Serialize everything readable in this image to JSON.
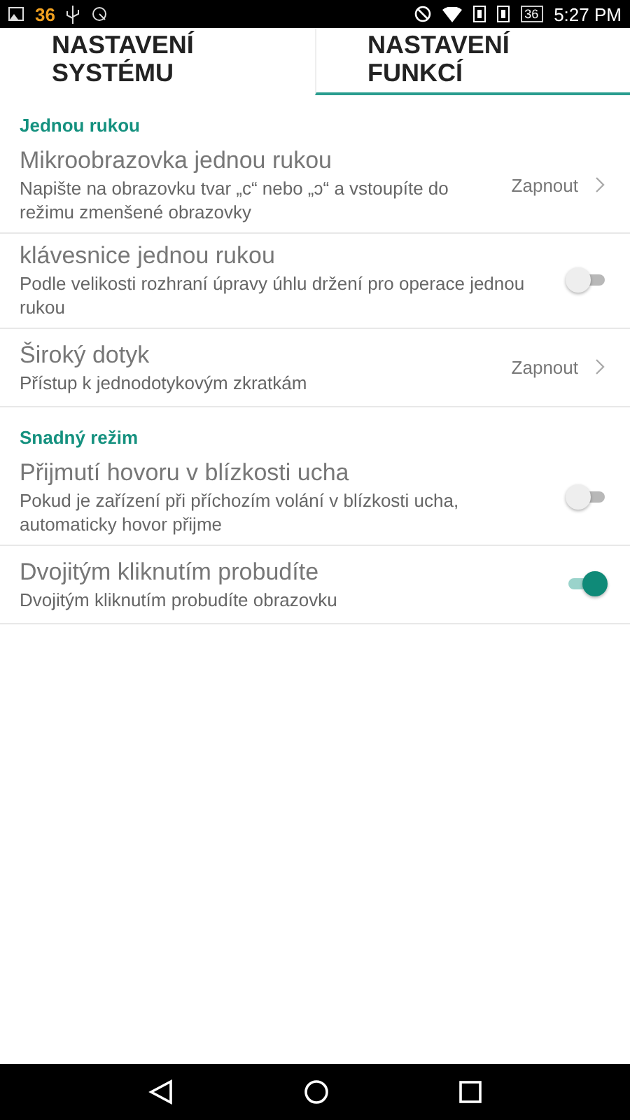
{
  "status_bar": {
    "notification_count": "36",
    "battery": "36",
    "time": "5:27 PM"
  },
  "tabs": [
    {
      "label": "NASTAVENÍ\nSYSTÉMU",
      "selected": false
    },
    {
      "label": "NASTAVENÍ\nFUNKCÍ",
      "selected": true
    }
  ],
  "sections": [
    {
      "title": "Jednou rukou",
      "items": [
        {
          "kind": "link",
          "title": "Mikroobrazovka jednou rukou",
          "subtitle": "Napište na obrazovku tvar „c“ nebo „ↄ“ a vstoupíte do režimu zmenšené obrazovky",
          "value": "Zapnout"
        },
        {
          "kind": "switch",
          "title": "klávesnice jednou rukou",
          "subtitle": "Podle velikosti rozhraní úpravy úhlu držení pro operace jednou rukou",
          "on": false
        },
        {
          "kind": "link",
          "title": "Široký dotyk",
          "subtitle": "Přístup k jednodotykovým zkratkám",
          "value": "Zapnout"
        }
      ]
    },
    {
      "title": "Snadný režim",
      "items": [
        {
          "kind": "switch",
          "title": "Přijmutí hovoru v blízkosti ucha",
          "subtitle": "Pokud je zařízení při příchozím volání v blízkosti ucha, automaticky hovor přijme",
          "on": false
        },
        {
          "kind": "switch",
          "title": "Dvojitým kliknutím probudíte",
          "subtitle": "Dvojitým kliknutím probudíte obrazovku",
          "on": true
        }
      ]
    }
  ]
}
